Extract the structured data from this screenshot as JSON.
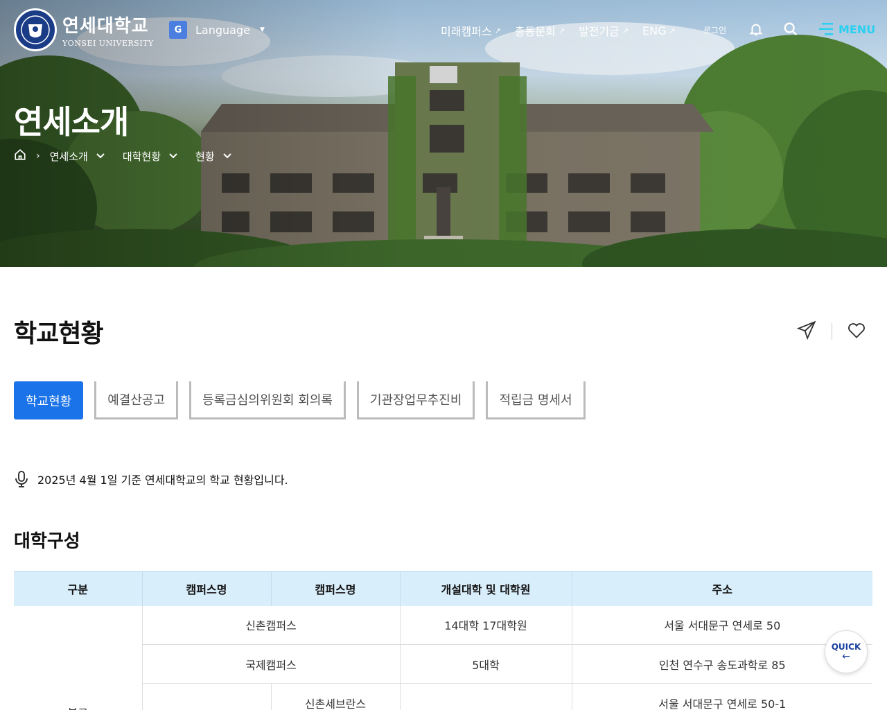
{
  "header": {
    "logo_kr": "연세대학교",
    "logo_en": "YONSEI UNIVERSITY",
    "language_label": "Language",
    "nav_links": [
      {
        "label": "미래캠퍼스"
      },
      {
        "label": "총동문회"
      },
      {
        "label": "발전기금"
      },
      {
        "label": "ENG"
      }
    ],
    "login_label": "로그인",
    "menu_label": "MENU",
    "accent_color": "#29d0ef"
  },
  "hero": {
    "title": "연세소개",
    "breadcrumb": [
      "연세소개",
      "대학현황",
      "현황"
    ]
  },
  "page": {
    "title": "학교현황",
    "tabs": [
      "학교현황",
      "예결산공고",
      "등록금심의위원회 회의록",
      "기관장업무추진비",
      "적립금 명세서"
    ],
    "active_tab_color": "#1a73e8",
    "notice": "2025년 4월 1일 기준 연세대학교의 학교 현황입니다.",
    "section_title": "대학구성"
  },
  "table": {
    "headers": [
      "구분",
      "캠퍼스명",
      "캠퍼스명",
      "개설대학 및 대학원",
      "주소"
    ],
    "group_label": "본교",
    "rows": [
      {
        "campus": "신촌캠퍼스",
        "colleges": "14대학 17대학원",
        "address": "서울 서대문구 연세로 50"
      },
      {
        "campus": "국제캠퍼스",
        "colleges": "5대학",
        "address": "인천 연수구 송도과학로 85"
      },
      {
        "campus_sub": "신촌세브란스",
        "colleges": "",
        "address": "서울 서대문구 연세로 50-1"
      }
    ],
    "header_bg": "#d9eefb"
  },
  "quick": {
    "label": "QUICK",
    "arrow": "←"
  }
}
